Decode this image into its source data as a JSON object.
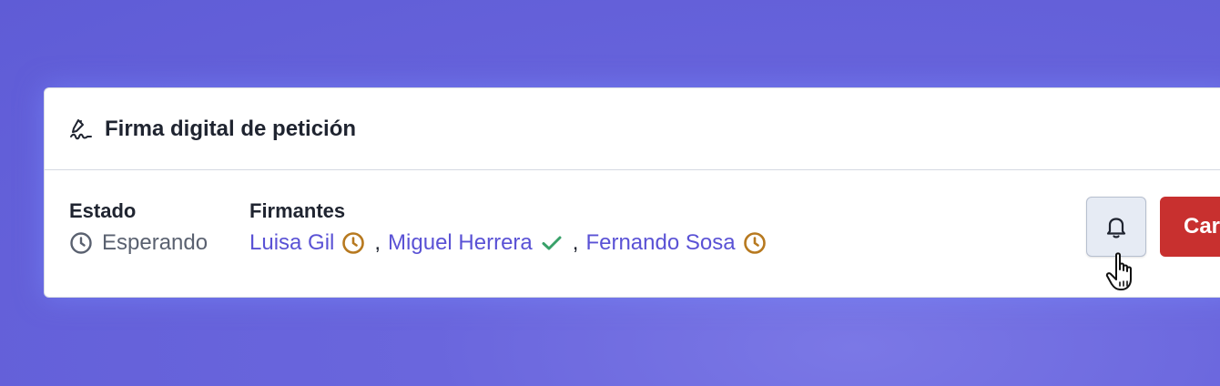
{
  "card": {
    "title": "Firma digital de petición",
    "title_icon": "signature-icon"
  },
  "estado": {
    "label": "Estado",
    "value": "Esperando",
    "icon": "clock-icon"
  },
  "firmantes": {
    "label": "Firmantes",
    "separator": ",",
    "items": [
      {
        "name": "Luisa Gil",
        "status": "pending",
        "icon": "clock-icon"
      },
      {
        "name": "Miguel Herrera",
        "status": "signed",
        "icon": "check-icon"
      },
      {
        "name": "Fernando Sosa",
        "status": "pending",
        "icon": "clock-icon"
      }
    ]
  },
  "actions": {
    "bell_icon": "bell-icon",
    "cancel_label": "Car"
  },
  "colors": {
    "background": "#6562da",
    "link": "#5a52d5",
    "pending": "#b7791f",
    "signed": "#38a169",
    "danger": "#c8302f",
    "text": "#1f2430",
    "muted": "#5a6170"
  }
}
